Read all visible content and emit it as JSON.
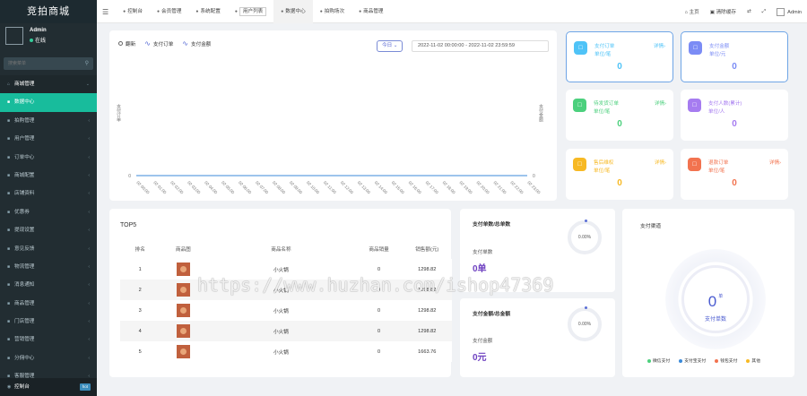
{
  "app_title": "竞拍商城",
  "user": {
    "name": "Admin",
    "status": "在线"
  },
  "search": {
    "placeholder": "搜索菜单"
  },
  "sidebar": {
    "group_label": "商城管理",
    "items": [
      {
        "label": "数据中心",
        "icon": "dashboard-icon"
      },
      {
        "label": "拍购管理",
        "icon": "list-icon"
      },
      {
        "label": "用户管理",
        "icon": "user-icon"
      },
      {
        "label": "订单中心",
        "icon": "order-icon"
      },
      {
        "label": "商城配置",
        "icon": "config-icon"
      },
      {
        "label": "店铺资料",
        "icon": "shop-icon"
      },
      {
        "label": "优惠券",
        "icon": "coupon-icon"
      },
      {
        "label": "提现设置",
        "icon": "withdraw-icon"
      },
      {
        "label": "意见反馈",
        "icon": "feedback-icon"
      },
      {
        "label": "物流管理",
        "icon": "logistics-icon"
      },
      {
        "label": "消息通知",
        "icon": "bell-icon"
      },
      {
        "label": "商品管理",
        "icon": "goods-icon"
      },
      {
        "label": "门店管理",
        "icon": "store-icon"
      },
      {
        "label": "营销管理",
        "icon": "marketing-icon"
      },
      {
        "label": "分佣中心",
        "icon": "commission-icon"
      },
      {
        "label": "客服管理",
        "icon": "service-icon"
      }
    ],
    "bottom_label": "控制台",
    "bottom_badge": "hot"
  },
  "topnav": {
    "tabs": [
      {
        "label": "控制台",
        "icon": "dashboard-icon"
      },
      {
        "label": "会员管理",
        "icon": "user-icon"
      },
      {
        "label": "系统配置",
        "icon": "gear-icon"
      },
      {
        "label": "用户列表",
        "icon": "list-icon"
      },
      {
        "label": "数据中心",
        "icon": "dashboard-icon"
      },
      {
        "label": "拍购场次",
        "icon": "clock-icon"
      },
      {
        "label": "商品管理",
        "icon": "goods-icon"
      }
    ],
    "right": {
      "home": "主页",
      "clear_cache": "清除缓存",
      "user": "Admin"
    }
  },
  "chart_controls": {
    "legend": [
      {
        "label": "翻新",
        "type": "circle"
      },
      {
        "label": "支付订单",
        "type": "line"
      },
      {
        "label": "支付金额",
        "type": "line"
      }
    ],
    "today": "今日",
    "date_range": "2022-11-02 00:00:00  -  2022-11-02 23:59:59"
  },
  "chart_data": {
    "type": "line",
    "ylabel_left": "支付订单",
    "ylabel_right": "支付金额",
    "x": [
      "00:00",
      "01:00",
      "02:00",
      "03:00",
      "04:00",
      "05:00",
      "06:00",
      "07:00",
      "08:00",
      "09:00",
      "10:00",
      "11:00",
      "12:00",
      "13:00",
      "14:00",
      "15:00",
      "16:00",
      "17:00",
      "18:00",
      "19:00",
      "20:00",
      "21:00",
      "22:00",
      "23:00"
    ],
    "x_tick_labels": [
      "02 00:00",
      "02 01:00",
      "02 02:00",
      "02 03:00",
      "02 04:00",
      "02 05:00",
      "02 06:00",
      "02 07:00",
      "02 08:00",
      "02 09:00",
      "02 10:00",
      "02 11:00",
      "02 12:00",
      "02 13:00",
      "02 14:00",
      "02 15:00",
      "02 16:00",
      "02 17:00",
      "02 18:00",
      "02 19:00",
      "02 20:00",
      "02 21:00",
      "02 22:00",
      "02 23:00"
    ],
    "series": [
      {
        "name": "支付订单",
        "values": [
          0,
          0,
          0,
          0,
          0,
          0,
          0,
          0,
          0,
          0,
          0,
          0,
          0,
          0,
          0,
          0,
          0,
          0,
          0,
          0,
          0,
          0,
          0,
          0
        ]
      },
      {
        "name": "支付金额",
        "values": [
          0,
          0,
          0,
          0,
          0,
          0,
          0,
          0,
          0,
          0,
          0,
          0,
          0,
          0,
          0,
          0,
          0,
          0,
          0,
          0,
          0,
          0,
          0,
          0
        ]
      }
    ],
    "y_tick_left": "0",
    "y_tick_right": "0",
    "colors": {
      "line": "#3b8ad9"
    }
  },
  "stats": [
    {
      "title": "支付订单",
      "unit": "单位/笔",
      "link": "详情",
      "value": "0",
      "color": "#4fc3f7",
      "icon": "order-icon",
      "bordered": true
    },
    {
      "title": "支付金额",
      "unit": "单位/元",
      "link": "",
      "value": "0",
      "color": "#7b8cf5",
      "icon": "money-icon",
      "bordered": true
    },
    {
      "title": "待发货订单",
      "unit": "单位/笔",
      "link": "详情",
      "value": "0",
      "color": "#4cd07d",
      "icon": "truck-icon",
      "bordered": false
    },
    {
      "title": "支付人数(累计)",
      "unit": "单位/人",
      "link": "",
      "value": "0",
      "color": "#a67cf0",
      "icon": "people-icon",
      "bordered": false
    },
    {
      "title": "售后维权",
      "unit": "单位/笔",
      "link": "详情",
      "value": "0",
      "color": "#f7b924",
      "icon": "shield-icon",
      "bordered": false
    },
    {
      "title": "退款订单",
      "unit": "单位/笔",
      "link": "详情",
      "value": "0",
      "color": "#f2734f",
      "icon": "refund-icon",
      "bordered": false
    }
  ],
  "top5": {
    "title": "TOP5",
    "headers": [
      "排名",
      "商品图",
      "商品名称",
      "商品销量",
      "销售额(元)"
    ],
    "rows": [
      {
        "rank": "1",
        "name": "小火锅",
        "sales": "0",
        "amount": "1298.82"
      },
      {
        "rank": "2",
        "name": "小火锅",
        "sales": "0",
        "amount": "1298.82"
      },
      {
        "rank": "3",
        "name": "小火锅",
        "sales": "0",
        "amount": "1298.82"
      },
      {
        "rank": "4",
        "name": "小火锅",
        "sales": "0",
        "amount": "1298.82"
      },
      {
        "rank": "5",
        "name": "小火锅",
        "sales": "0",
        "amount": "1663.76"
      }
    ]
  },
  "ratio_orders": {
    "title": "支付单数/总单数",
    "label": "支付单数",
    "value": "0单",
    "percent": "0.00%"
  },
  "ratio_amount": {
    "title": "支付金额/总金额",
    "label": "支付金额",
    "value": "0元",
    "percent": "0.00%"
  },
  "channel": {
    "title": "支付渠道",
    "value": "0",
    "unit": "单",
    "label": "支付单数",
    "legend": [
      {
        "label": "微信支付",
        "color": "#4cd07d"
      },
      {
        "label": "支付宝支付",
        "color": "#3b8ad9"
      },
      {
        "label": "钱包支付",
        "color": "#f2734f"
      },
      {
        "label": "其他",
        "color": "#f7b924"
      }
    ]
  },
  "watermark": "https://www.huzhan.com/ishop47369"
}
